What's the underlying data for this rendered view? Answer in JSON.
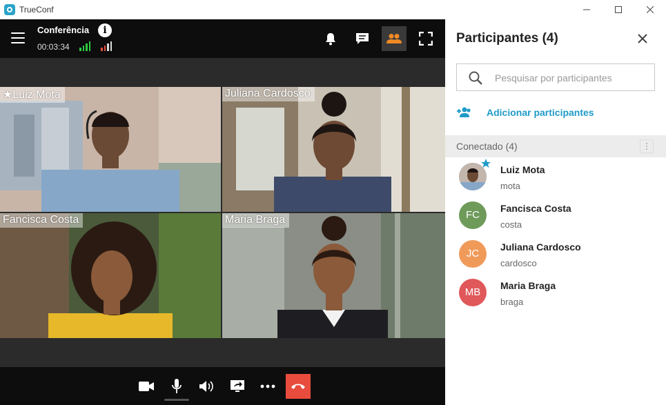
{
  "window": {
    "app_title": "TrueConf",
    "controls": [
      "minimize",
      "maximize",
      "close"
    ]
  },
  "call": {
    "conference_label": "Conferência",
    "timer": "00:03:34",
    "toolbar_icons": [
      "bell-icon",
      "chat-icon",
      "participants-icon",
      "fullscreen-icon"
    ],
    "tiles": [
      {
        "name": "Luiz Mota",
        "moderator": true
      },
      {
        "name": "Juliana Cardosco",
        "moderator": false
      },
      {
        "name": "Fancisca Costa",
        "moderator": false
      },
      {
        "name": "Maria Braga",
        "moderator": false
      }
    ],
    "bottom_icons": [
      "camera-icon",
      "microphone-icon",
      "speaker-icon",
      "share-screen-icon",
      "more-icon",
      "hang-up-icon"
    ],
    "colors": {
      "hangup": "#e84c3d",
      "signal_good": "#2ecc40",
      "signal_bad": "#e84c3d"
    }
  },
  "panel": {
    "title": "Participantes (4)",
    "search_placeholder": "Pesquisar por participantes",
    "add_label": "Adicionar participantes",
    "section_label": "Conectado (4)",
    "accent": "#1f9bc7",
    "participants": [
      {
        "name": "Luiz Mota",
        "login": "mota",
        "initials": "",
        "color": "#8aa0b8",
        "moderator": true
      },
      {
        "name": "Fancisca Costa",
        "login": "costa",
        "initials": "FC",
        "color": "#6e9a5a",
        "moderator": false
      },
      {
        "name": "Juliana Cardosco",
        "login": "cardosco",
        "initials": "JC",
        "color": "#f09a5a",
        "moderator": false
      },
      {
        "name": "Maria Braga",
        "login": "braga",
        "initials": "MB",
        "color": "#e0585a",
        "moderator": false
      }
    ]
  }
}
